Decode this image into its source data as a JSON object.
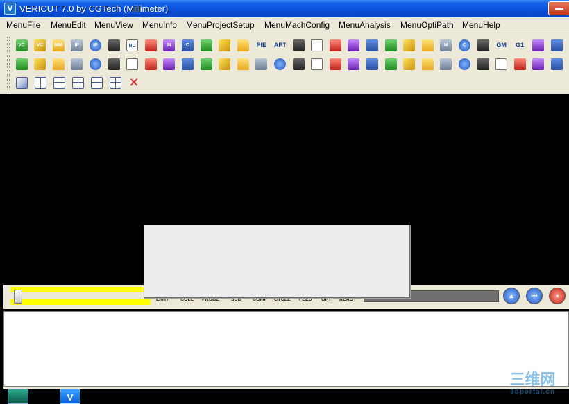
{
  "window": {
    "title": "VERICUT 7.0 by CGTech (Millimeter)",
    "app_icon_glyph": "V"
  },
  "menubar": {
    "items": [
      {
        "label": "MenuFile"
      },
      {
        "label": "MenuEdit"
      },
      {
        "label": "MenuView"
      },
      {
        "label": "MenuInfo"
      },
      {
        "label": "MenuProjectSetup"
      },
      {
        "label": "MenuMachConfig"
      },
      {
        "label": "MenuAnalysis"
      },
      {
        "label": "MenuOptiPath"
      },
      {
        "label": "MenuHelp"
      }
    ]
  },
  "toolbar": {
    "row1": [
      {
        "icon": "open-project-icon",
        "glyph": "VC"
      },
      {
        "icon": "save-project-icon",
        "glyph": "VC"
      },
      {
        "icon": "open-mm-icon",
        "glyph": "MM"
      },
      {
        "icon": "open-ip-icon",
        "glyph": "IP"
      },
      {
        "icon": "save-ip-icon",
        "glyph": "IP"
      },
      {
        "icon": "import-icon",
        "glyph": ""
      },
      {
        "icon": "nc-program-icon",
        "glyph": "NC"
      },
      {
        "icon": "nc-viewer-icon",
        "glyph": ""
      },
      {
        "icon": "open-machine-icon",
        "glyph": "M"
      },
      {
        "icon": "open-control-icon",
        "glyph": "C"
      },
      {
        "icon": "tool-manager-icon",
        "glyph": ""
      },
      {
        "icon": "enter-icon",
        "glyph": ""
      },
      {
        "icon": "setup-icon",
        "glyph": ""
      },
      {
        "icon": "pipe-icon",
        "glyph": "PIE"
      },
      {
        "icon": "apt-icon",
        "glyph": "APT"
      },
      {
        "icon": "report-icon",
        "glyph": ""
      },
      {
        "icon": "fixture-icon",
        "glyph": ""
      },
      {
        "icon": "save-icon",
        "glyph": ""
      },
      {
        "icon": "globe-icon",
        "glyph": ""
      },
      {
        "icon": "check-icon",
        "glyph": ""
      },
      {
        "icon": "calculator-icon",
        "glyph": ""
      },
      {
        "icon": "tool-path-icon",
        "glyph": ""
      },
      {
        "icon": "target-icon",
        "glyph": ""
      },
      {
        "icon": "machine-icon",
        "glyph": "M"
      },
      {
        "icon": "control-icon",
        "glyph": "C"
      },
      {
        "icon": "component-icon",
        "glyph": ""
      },
      {
        "icon": "gm-codes-icon",
        "glyph": "GM"
      },
      {
        "icon": "g1-icon",
        "glyph": "G1"
      },
      {
        "icon": "variables-icon",
        "glyph": ""
      },
      {
        "icon": "qr-icon",
        "glyph": ""
      }
    ],
    "row2": [
      {
        "icon": "eraser-icon"
      },
      {
        "icon": "cut-icon"
      },
      {
        "icon": "material-icon"
      },
      {
        "icon": "cube-icon"
      },
      {
        "icon": "box-icon"
      },
      {
        "icon": "paint-icon"
      },
      {
        "icon": "zoom-fit-icon"
      },
      {
        "icon": "zoom-in-icon"
      },
      {
        "icon": "zoom-out-icon"
      },
      {
        "icon": "fit-all-icon"
      },
      {
        "icon": "eye-icon"
      },
      {
        "icon": "rotate-icon"
      },
      {
        "icon": "mirror-icon"
      },
      {
        "icon": "probe-icon"
      },
      {
        "icon": "info-icon"
      },
      {
        "icon": "graph-icon"
      },
      {
        "icon": "section-icon"
      },
      {
        "icon": "delete-cut-icon"
      },
      {
        "icon": "color-cube-icon"
      },
      {
        "icon": "lightning-icon"
      },
      {
        "icon": "compare-icon"
      },
      {
        "icon": "hatch-icon"
      },
      {
        "icon": "camera-icon"
      },
      {
        "icon": "film-icon"
      },
      {
        "icon": "image-icon"
      },
      {
        "icon": "print-icon"
      },
      {
        "icon": "x-axis-icon"
      },
      {
        "icon": "y-axis-icon"
      },
      {
        "icon": "z-axis-icon"
      },
      {
        "icon": "gear-icon"
      }
    ],
    "row3": [
      {
        "icon": "single-view-icon",
        "style": "single"
      },
      {
        "icon": "two-vertical-views-icon",
        "style": "split-v"
      },
      {
        "icon": "two-horizontal-views-icon",
        "style": "split-h"
      },
      {
        "icon": "three-views-icon",
        "style": "quad"
      },
      {
        "icon": "three-views-alt-icon",
        "style": "split-h"
      },
      {
        "icon": "four-views-icon",
        "style": "quad"
      },
      {
        "icon": "close-view-icon",
        "style": "x"
      }
    ],
    "close_glyph": "✕"
  },
  "status": {
    "labels": [
      "LIMIT",
      "COLL",
      "PROBE",
      "SUB",
      "COMP",
      "CYCLE",
      "FEED",
      "OPTI",
      "READY"
    ],
    "indicator_color": "#ffff00",
    "buttons": [
      {
        "name": "rewind-up-button",
        "glyph": "▲"
      },
      {
        "name": "reset-button",
        "glyph": "⏮"
      },
      {
        "name": "stop-button",
        "glyph": "⏸"
      }
    ]
  },
  "taskbar": {
    "icon_two_glyph": "V"
  },
  "watermark": {
    "cn": "三维网",
    "en": "3dportal.cn"
  },
  "colors": {
    "titlebar": "#0a4fd8",
    "chrome": "#ece9d8",
    "viewport": "#000000",
    "indicator": "#ffff00"
  }
}
